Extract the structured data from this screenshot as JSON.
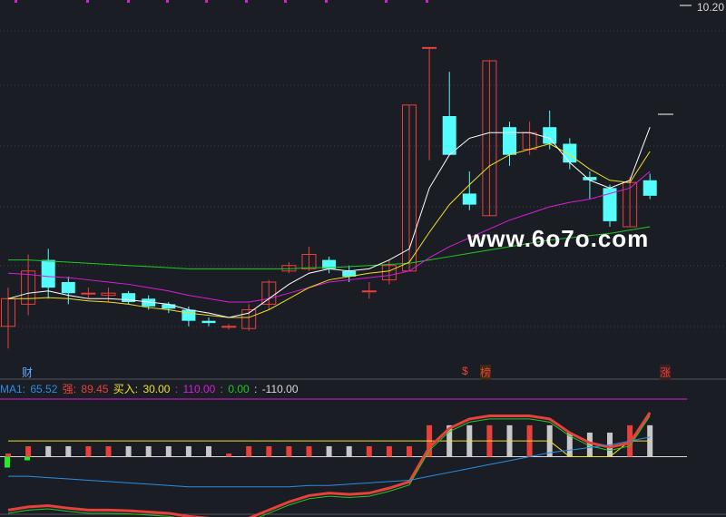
{
  "price_label": "10.20",
  "watermark": "www.6o7o.com",
  "tags": {
    "cai": "财",
    "dollar": "$",
    "bang": "榜",
    "zhang": "涨"
  },
  "indicator": {
    "ma1_label": "MA1: ",
    "ma1_value": "65.52",
    "qiang_label": "强: ",
    "qiang_value": "89.45",
    "mairu_label": "买入: ",
    "mairu_value": "30.00",
    "v110_label": ": ",
    "v110_value": "110.00",
    "v0_label": ": ",
    "v0_value": "0.00",
    "vm110_label": ": ",
    "vm110_value": "-110.00"
  },
  "colors": {
    "up": "#e8413b",
    "down": "#54fdfb",
    "ma_white": "#ffffff",
    "ma_yellow": "#f0e022",
    "ma_magenta": "#d81ed8",
    "ma_green": "#22c922",
    "ind_blue": "#2a8ee0",
    "bar_grey": "#c8c8c8"
  },
  "chart_data": {
    "type": "candlestick",
    "price_label": "10.20",
    "candles": [
      {
        "o": 7.3,
        "c": 7.55,
        "h": 7.65,
        "l": 7.1
      },
      {
        "o": 7.5,
        "c": 7.8,
        "h": 7.95,
        "l": 7.4
      },
      {
        "o": 7.9,
        "c": 7.65,
        "h": 8.0,
        "l": 7.55
      },
      {
        "o": 7.7,
        "c": 7.6,
        "h": 7.75,
        "l": 7.5
      },
      {
        "o": 7.6,
        "c": 7.6,
        "h": 7.65,
        "l": 7.55
      },
      {
        "o": 7.58,
        "c": 7.6,
        "h": 7.65,
        "l": 7.52
      },
      {
        "o": 7.6,
        "c": 7.52,
        "h": 7.62,
        "l": 7.5
      },
      {
        "o": 7.55,
        "c": 7.48,
        "h": 7.58,
        "l": 7.45
      },
      {
        "o": 7.5,
        "c": 7.46,
        "h": 7.52,
        "l": 7.42
      },
      {
        "o": 7.45,
        "c": 7.35,
        "h": 7.48,
        "l": 7.3
      },
      {
        "o": 7.35,
        "c": 7.33,
        "h": 7.38,
        "l": 7.3
      },
      {
        "o": 7.3,
        "c": 7.3,
        "h": 7.32,
        "l": 7.27
      },
      {
        "o": 7.28,
        "c": 7.45,
        "h": 7.5,
        "l": 7.26
      },
      {
        "o": 7.5,
        "c": 7.7,
        "h": 7.72,
        "l": 7.45
      },
      {
        "o": 7.8,
        "c": 7.85,
        "h": 7.88,
        "l": 7.78
      },
      {
        "o": 7.82,
        "c": 7.95,
        "h": 8.02,
        "l": 7.8
      },
      {
        "o": 7.9,
        "c": 7.82,
        "h": 7.93,
        "l": 7.78
      },
      {
        "o": 7.8,
        "c": 7.75,
        "h": 7.85,
        "l": 7.7
      },
      {
        "o": 7.62,
        "c": 7.62,
        "h": 7.7,
        "l": 7.55
      },
      {
        "o": 7.72,
        "c": 7.85,
        "h": 7.9,
        "l": 7.68
      },
      {
        "o": 7.8,
        "c": 9.3,
        "h": 9.3,
        "l": 7.8
      },
      {
        "o": 9.82,
        "c": 9.82,
        "h": 9.82,
        "l": 8.8
      },
      {
        "o": 9.2,
        "c": 8.85,
        "h": 9.6,
        "l": 8.85
      },
      {
        "o": 8.5,
        "c": 8.4,
        "h": 8.7,
        "l": 8.35
      },
      {
        "o": 8.3,
        "c": 9.7,
        "h": 9.7,
        "l": 8.3
      },
      {
        "o": 9.1,
        "c": 8.85,
        "h": 9.15,
        "l": 8.75
      },
      {
        "o": 8.9,
        "c": 9.05,
        "h": 9.15,
        "l": 8.85
      },
      {
        "o": 9.1,
        "c": 8.95,
        "h": 9.25,
        "l": 8.9
      },
      {
        "o": 8.95,
        "c": 8.78,
        "h": 9.0,
        "l": 8.72
      },
      {
        "o": 8.65,
        "c": 8.62,
        "h": 8.7,
        "l": 8.45
      },
      {
        "o": 8.55,
        "c": 8.25,
        "h": 8.58,
        "l": 8.2
      },
      {
        "o": 8.2,
        "c": 8.6,
        "h": 8.65,
        "l": 8.2
      },
      {
        "o": 8.62,
        "c": 8.48,
        "h": 8.68,
        "l": 8.45
      }
    ],
    "ma_white": [
      7.55,
      7.6,
      7.62,
      7.58,
      7.55,
      7.55,
      7.54,
      7.52,
      7.5,
      7.45,
      7.42,
      7.38,
      7.42,
      7.55,
      7.68,
      7.78,
      7.82,
      7.8,
      7.82,
      7.9,
      8.0,
      8.55,
      8.85,
      9.0,
      9.05,
      9.05,
      9.05,
      9.0,
      8.78,
      8.62,
      8.55,
      8.62,
      9.1
    ],
    "ma_yellow": [
      7.55,
      7.55,
      7.56,
      7.55,
      7.53,
      7.52,
      7.5,
      7.47,
      7.45,
      7.42,
      7.4,
      7.38,
      7.38,
      7.45,
      7.55,
      7.65,
      7.72,
      7.75,
      7.78,
      7.8,
      7.88,
      8.15,
      8.4,
      8.58,
      8.75,
      8.85,
      8.9,
      8.95,
      8.85,
      8.72,
      8.62,
      8.6,
      8.88
    ],
    "ma_magenta": [
      7.78,
      7.77,
      7.75,
      7.74,
      7.72,
      7.7,
      7.68,
      7.65,
      7.62,
      7.58,
      7.55,
      7.52,
      7.52,
      7.55,
      7.6,
      7.65,
      7.7,
      7.72,
      7.74,
      7.76,
      7.8,
      7.92,
      8.02,
      8.1,
      8.18,
      8.26,
      8.32,
      8.38,
      8.42,
      8.45,
      8.5,
      8.55,
      8.7
    ],
    "ma_green": [
      7.9,
      7.9,
      7.89,
      7.88,
      7.87,
      7.86,
      7.85,
      7.84,
      7.83,
      7.82,
      7.82,
      7.82,
      7.82,
      7.82,
      7.82,
      7.83,
      7.83,
      7.84,
      7.85,
      7.86,
      7.87,
      7.9,
      7.93,
      7.96,
      7.99,
      8.02,
      8.05,
      8.08,
      8.1,
      8.12,
      8.14,
      8.17,
      8.2
    ],
    "indicator_legend": [
      "MA1: 65.52",
      "强: 89.45",
      "买入: 30.00",
      ": 110.00",
      ": 0.00",
      ": -110.00"
    ]
  }
}
